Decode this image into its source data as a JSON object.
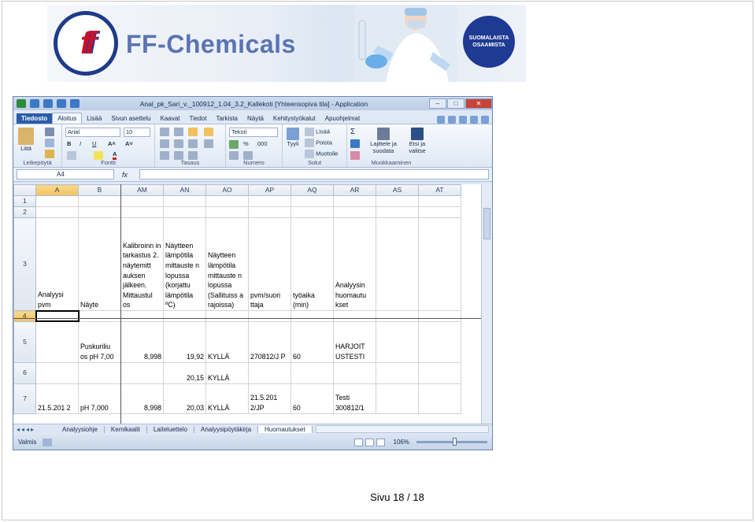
{
  "banner": {
    "logo_text": "ff",
    "brand": "FF-Chemicals",
    "seal_text": "SUOMALAISTA OSAAMISTA"
  },
  "excel": {
    "title": "Anal_pk_Sari_v._100912_1.04_3.2_Kallekoti  [Yhteensopiva tila]  -  Application",
    "tabs": [
      "Tiedosto",
      "Aloitus",
      "Lisää",
      "Sivun asettelu",
      "Kaavat",
      "Tiedot",
      "Tarkista",
      "Näytä",
      "Kehitystyökalut",
      "Apuohjelmat"
    ],
    "ribbon": {
      "paste": "Liitä",
      "font_name": "Arial",
      "font_size": "10",
      "bold": "B",
      "italic": "I",
      "underline": "U",
      "number_format": "Teksti",
      "percent": "%",
      "thousands": "000",
      "style": "Tyyli",
      "insert": "Lisää",
      "delete": "Poista",
      "format": "Muotoile",
      "sort": "Lajittele ja suodata",
      "find": "Etsi ja valitse",
      "groups": [
        "Leikepöytä",
        "Fontti",
        "Tasaus",
        "Numero",
        "Solut",
        "Muokkaaminen"
      ]
    },
    "name_box": "A4",
    "fx": "fx",
    "columns": [
      "A",
      "B",
      "AM",
      "AN",
      "AO",
      "AP",
      "AQ",
      "AR",
      "AS",
      "AT"
    ],
    "rows": [
      {
        "num": "1",
        "cells": [
          "",
          "",
          "",
          "",
          "",
          "",
          "",
          "",
          "",
          ""
        ]
      },
      {
        "num": "2",
        "cells": [
          "",
          "",
          "",
          "",
          "",
          "",
          "",
          "",
          "",
          ""
        ]
      },
      {
        "num": "3",
        "cells": [
          "Analyysi pvm",
          "Näyte",
          "Kalibroinn in tarkastus 2. näytemitt auksen jälkeen. Mittaustul os",
          "Näytteen lämpötila mittauste n lopussa (korjattu lämpötila ºC)",
          "Näytteen lämpötila mittauste n lopussa (Sallituiss a rajoissa)",
          "pvm/suori ttaja",
          "työaika (min)",
          "Analyysin huomautu kset",
          "",
          ""
        ]
      },
      {
        "num": "4",
        "cells": [
          "",
          "",
          "",
          "",
          "",
          "",
          "",
          "",
          "",
          ""
        ]
      },
      {
        "num": "5",
        "cells": [
          "",
          "Puskuriliu os pH 7,00",
          "8,998",
          "19,92",
          "KYLLÄ",
          "270812/J P",
          "60",
          "HARJOIT USTESTI",
          "",
          ""
        ]
      },
      {
        "num": "6",
        "cells": [
          "",
          "",
          "",
          "20,15",
          "KYLLÄ",
          "",
          "",
          "",
          "",
          ""
        ]
      },
      {
        "num": "7",
        "cells": [
          "21.5.201 2",
          "pH 7,000",
          "8,998",
          "20,03",
          "KYLLÄ",
          "21.5.201 2/JP",
          "60",
          "Testi 300812/1",
          "",
          ""
        ]
      }
    ],
    "sheet_tabs": [
      "Analyysiohje",
      "Kemikaalit",
      "Laiteluettelo",
      "Analyysipöytäkirja",
      "Huomautukset"
    ],
    "active_sheet": "Huomautukset",
    "status": "Valmis",
    "zoom": "106%"
  },
  "footer": "Sivu 18 / 18"
}
